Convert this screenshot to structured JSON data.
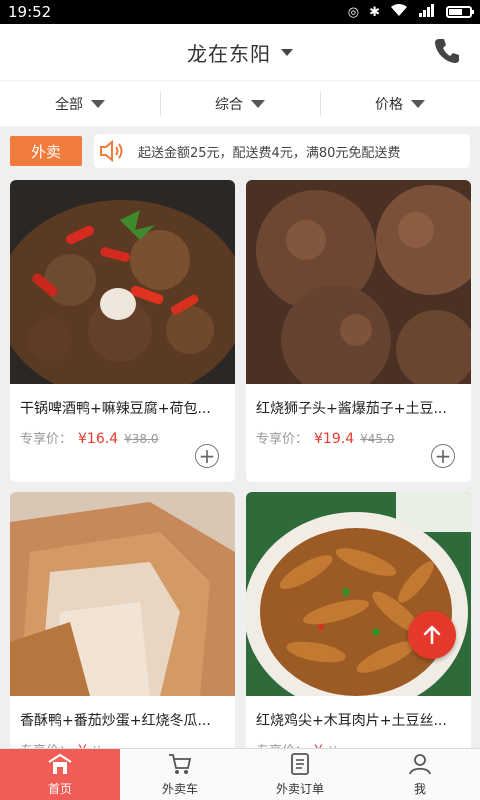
{
  "status": {
    "time": "19:52"
  },
  "header": {
    "title": "龙在东阳"
  },
  "filters": [
    {
      "label": "全部"
    },
    {
      "label": "综合"
    },
    {
      "label": "价格"
    }
  ],
  "notice": {
    "tag": "外卖",
    "text": "起送金额25元，配送费4元，满80元免配送费"
  },
  "products": [
    {
      "name": "干锅啤酒鸭+嘛辣豆腐+荷包...",
      "price_label": "专享价：",
      "price": "¥16.4",
      "old_price": "¥38.0"
    },
    {
      "name": "红烧狮子头+酱爆茄子+土豆...",
      "price_label": "专享价：",
      "price": "¥19.4",
      "old_price": "¥45.0"
    },
    {
      "name": "香酥鸭+番茄炒蛋+红烧冬瓜...",
      "price_label": "专享价：",
      "price": "¥",
      "old_price": "¥"
    },
    {
      "name": "红烧鸡尖+木耳肉片+土豆丝...",
      "price_label": "专享价：",
      "price": "¥",
      "old_price": "¥"
    }
  ],
  "tabs": [
    {
      "label": "首页",
      "icon": "home-icon",
      "active": true
    },
    {
      "label": "外卖车",
      "icon": "cart-icon",
      "active": false
    },
    {
      "label": "外卖订单",
      "icon": "order-icon",
      "active": false
    },
    {
      "label": "我",
      "icon": "person-icon",
      "active": false
    }
  ],
  "colors": {
    "accent": "#e43b2c",
    "tag": "#f07b3a",
    "active_tab": "#f05c56"
  }
}
